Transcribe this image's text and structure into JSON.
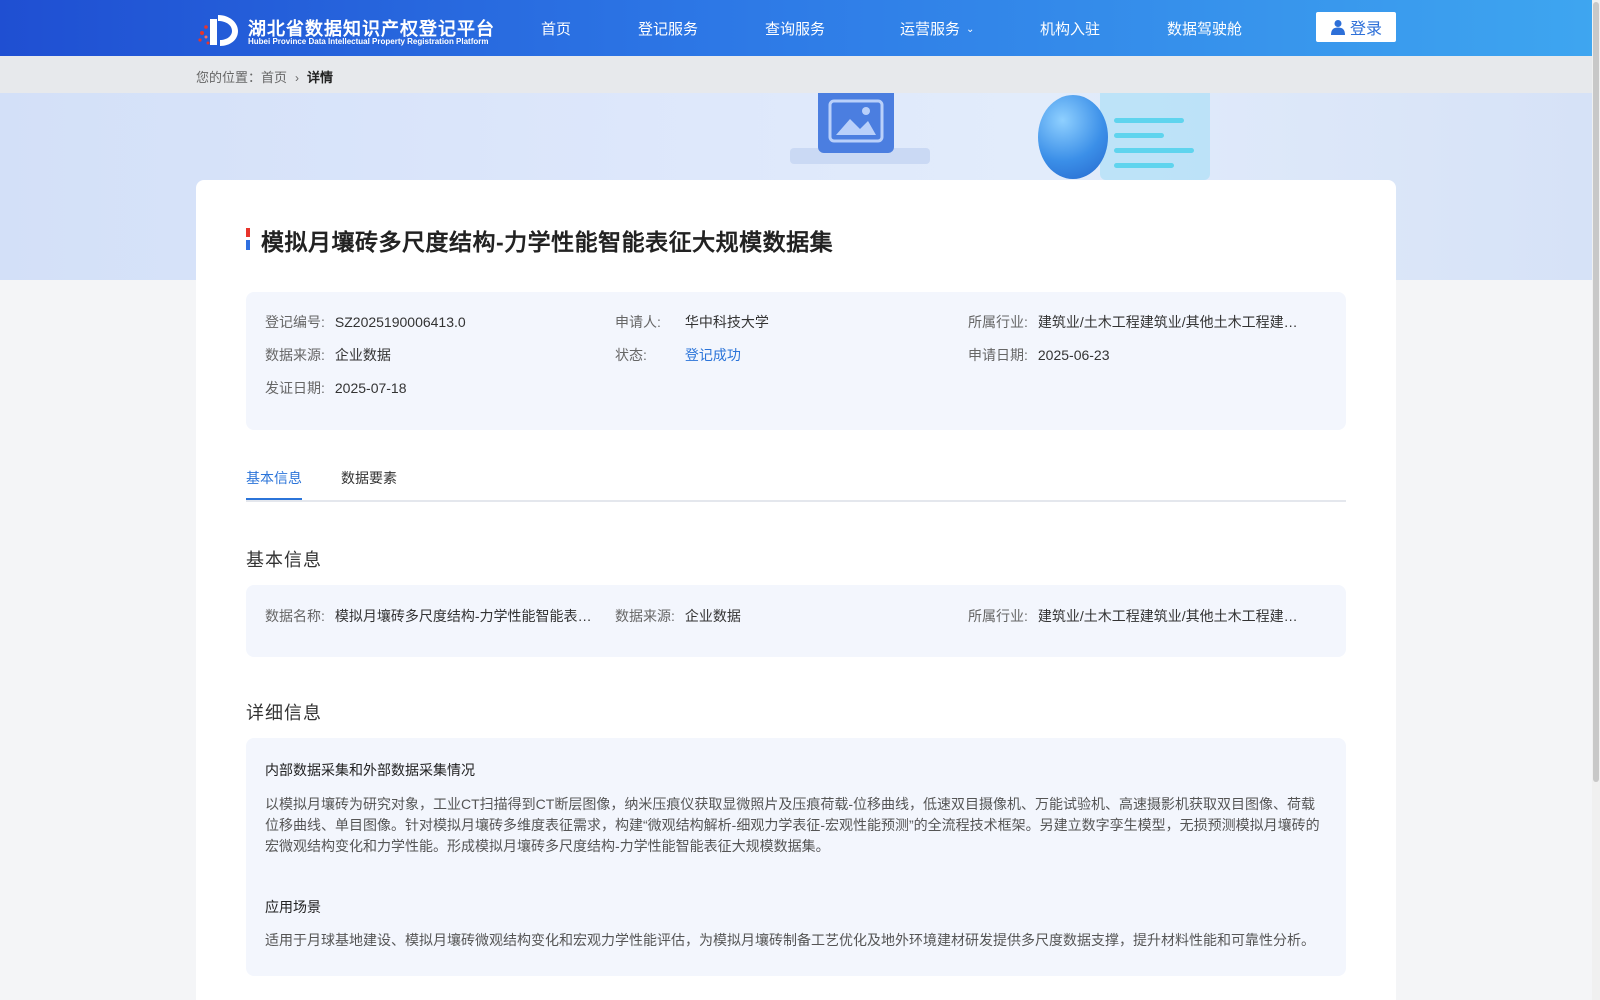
{
  "header": {
    "logo_cn": "湖北省数据知识产权登记平台",
    "logo_en": "Hubei Province Data Intellectual Property Registration Platform",
    "nav": [
      "首页",
      "登记服务",
      "查询服务",
      "运营服务",
      "机构入驻",
      "数据驾驶舱"
    ],
    "login_label": "登录"
  },
  "breadcrumb": {
    "prefix": "您的位置：",
    "home": "首页",
    "current": "详情"
  },
  "record": {
    "title": "模拟月壤砖多尺度结构-力学性能智能表征大规模数据集",
    "fields": {
      "reg_no": {
        "k": "登记编号:",
        "v": "SZ2025190006413.0"
      },
      "applicant": {
        "k": "申请人:",
        "v": "华中科技大学"
      },
      "industry": {
        "k": "所属行业:",
        "v": "建筑业/土木工程建筑业/其他土木工程建筑施工"
      },
      "source": {
        "k": "数据来源:",
        "v": "企业数据"
      },
      "status": {
        "k": "状态:",
        "v": "登记成功"
      },
      "apply_date": {
        "k": "申请日期:",
        "v": "2025-06-23"
      },
      "cert_date": {
        "k": "发证日期:",
        "v": "2025-07-18"
      }
    }
  },
  "tabs": [
    "基本信息",
    "数据要素"
  ],
  "basic": {
    "title": "基本信息",
    "name": {
      "k": "数据名称:",
      "v": "模拟月壤砖多尺度结构-力学性能智能表征大规模数据集"
    },
    "source": {
      "k": "数据来源:",
      "v": "企业数据"
    },
    "industry": {
      "k": "所属行业:",
      "v": "建筑业/土木工程建筑业/其他土木工程建筑施工"
    }
  },
  "detail": {
    "title": "详细信息",
    "collect_head": "内部数据采集和外部数据采集情况",
    "collect_text": "以模拟月壤砖为研究对象，工业CT扫描得到CT断层图像，纳米压痕仪获取显微照片及压痕荷载-位移曲线，低速双目摄像机、万能试验机、高速摄影机获取双目图像、荷载位移曲线、单目图像。针对模拟月壤砖多维度表征需求，构建“微观结构解析-细观力学表征-宏观性能预测”的全流程技术框架。另建立数字孪生模型，无损预测模拟月壤砖的宏微观结构变化和力学性能。形成模拟月壤砖多尺度结构-力学性能智能表征大规模数据集。",
    "scene_head": "应用场景",
    "scene_text": "适用于月球基地建设、模拟月壤砖微观结构变化和宏观力学性能评估，为模拟月壤砖制备工艺优化及地外环境建材研发提供多尺度数据支撑，提升材料性能和可靠性分析。"
  },
  "colors": {
    "accent": "#2b74d9",
    "header_start": "#1f4fd2",
    "header_end": "#3ea6f0",
    "panel_bg": "#f3f6fd"
  }
}
